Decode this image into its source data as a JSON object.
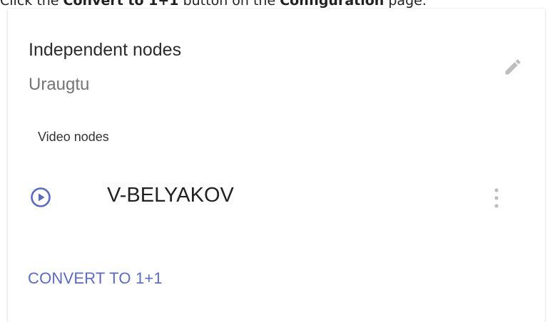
{
  "instruction": {
    "prefix": "Click the ",
    "button_name": "Convert to 1+1",
    "middle": " button on the ",
    "page_name": "Configuration",
    "suffix": " page."
  },
  "card": {
    "title": "Independent nodes",
    "subtitle": "Uraugtu",
    "section_label": "Video nodes",
    "nodes": [
      {
        "name": "V-BELYAKOV",
        "icon": "play-circle-icon"
      }
    ],
    "convert_label": "CONVERT TO 1+1"
  },
  "colors": {
    "accent": "#5c6bc0",
    "icon_gray": "#bdbdbd",
    "title_text": "#2b2b2b",
    "subtitle_text": "#757575"
  }
}
